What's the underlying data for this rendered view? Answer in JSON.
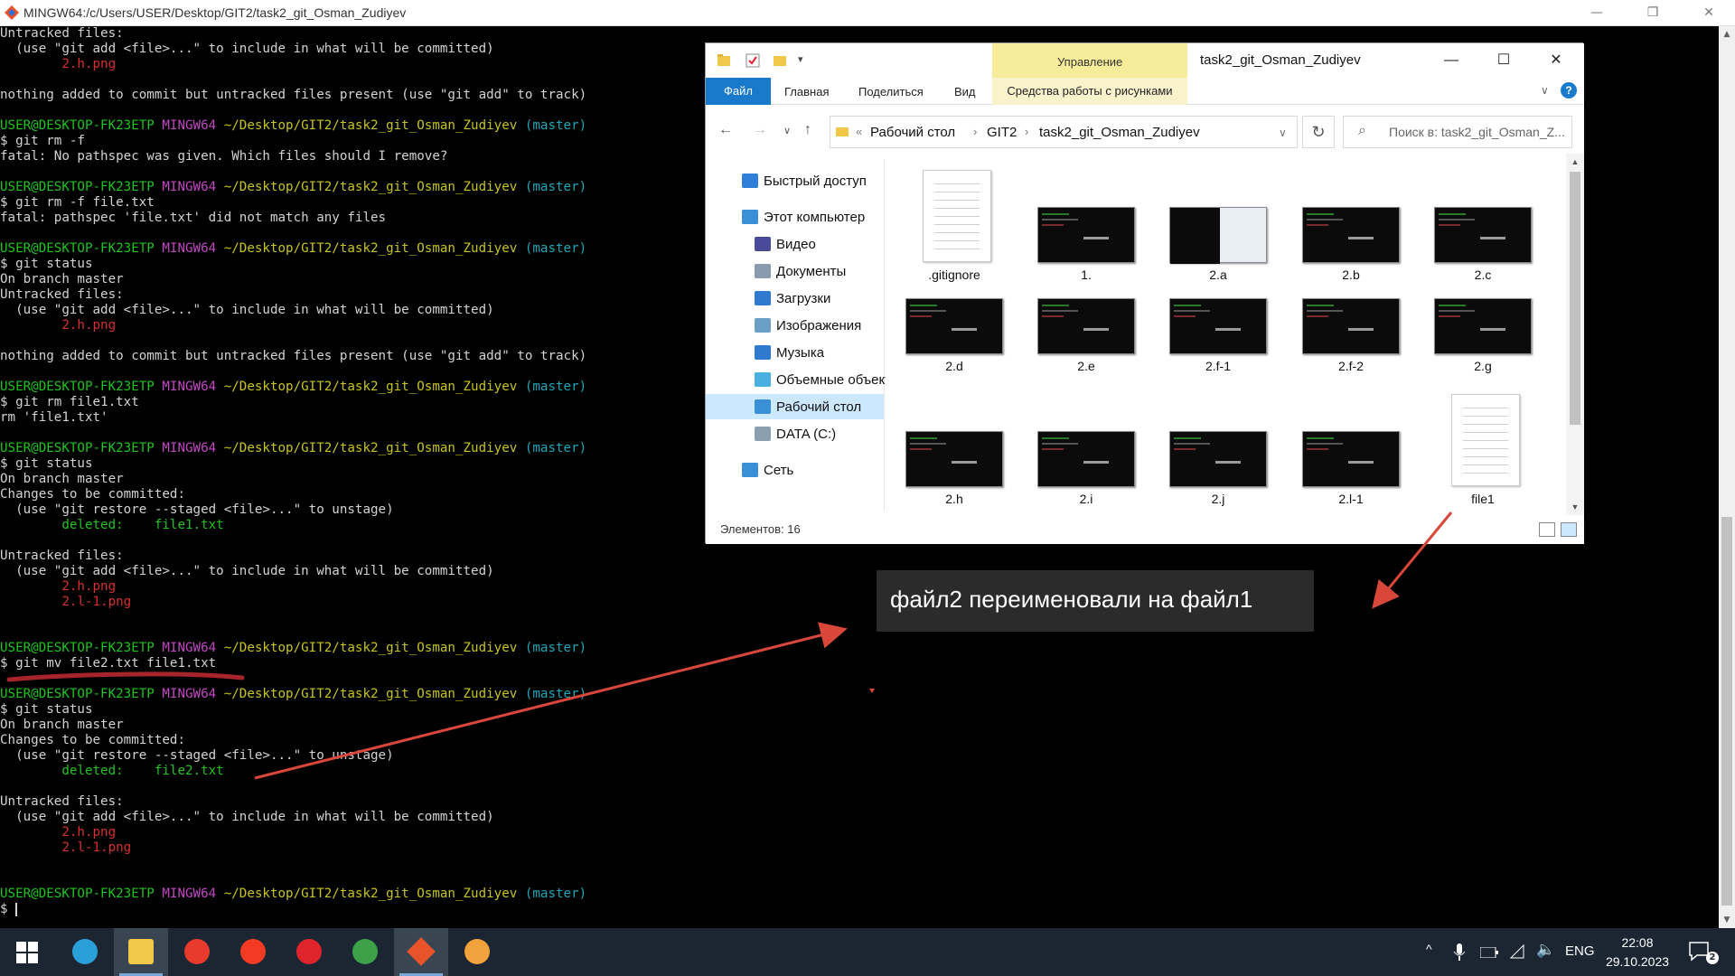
{
  "window": {
    "title": "MINGW64:/c/Users/USER/Desktop/GIT2/task2_git_Osman_Zudiyev",
    "minimize": "—",
    "maximize": "❐",
    "close": "✕"
  },
  "terminal": {
    "lines": [
      [
        [
          "w",
          "Untracked files:"
        ]
      ],
      [
        [
          "w",
          "  (use \"git add <file>...\" to include in what will be committed)"
        ]
      ],
      [
        [
          "r",
          "        2.h.png"
        ]
      ],
      [
        [
          "w",
          ""
        ]
      ],
      [
        [
          "w",
          "nothing added to commit but untracked files present (use \"git add\" to track)"
        ]
      ],
      [
        [
          "w",
          ""
        ]
      ],
      [
        [
          "g",
          "USER@DESKTOP-FK23ETP "
        ],
        [
          "m",
          "MINGW64 "
        ],
        [
          "y",
          "~/Desktop/GIT2/task2_git_Osman_Zudiyev "
        ],
        [
          "c",
          "(master)"
        ]
      ],
      [
        [
          "w",
          "$ git rm -f"
        ]
      ],
      [
        [
          "w",
          "fatal: No pathspec was given. Which files should I remove?"
        ]
      ],
      [
        [
          "w",
          ""
        ]
      ],
      [
        [
          "g",
          "USER@DESKTOP-FK23ETP "
        ],
        [
          "m",
          "MINGW64 "
        ],
        [
          "y",
          "~/Desktop/GIT2/task2_git_Osman_Zudiyev "
        ],
        [
          "c",
          "(master)"
        ]
      ],
      [
        [
          "w",
          "$ git rm -f file.txt"
        ]
      ],
      [
        [
          "w",
          "fatal: pathspec 'file.txt' did not match any files"
        ]
      ],
      [
        [
          "w",
          ""
        ]
      ],
      [
        [
          "g",
          "USER@DESKTOP-FK23ETP "
        ],
        [
          "m",
          "MINGW64 "
        ],
        [
          "y",
          "~/Desktop/GIT2/task2_git_Osman_Zudiyev "
        ],
        [
          "c",
          "(master)"
        ]
      ],
      [
        [
          "w",
          "$ git status"
        ]
      ],
      [
        [
          "w",
          "On branch master"
        ]
      ],
      [
        [
          "w",
          "Untracked files:"
        ]
      ],
      [
        [
          "w",
          "  (use \"git add <file>...\" to include in what will be committed)"
        ]
      ],
      [
        [
          "r",
          "        2.h.png"
        ]
      ],
      [
        [
          "w",
          ""
        ]
      ],
      [
        [
          "w",
          "nothing added to commit but untracked files present (use \"git add\" to track)"
        ]
      ],
      [
        [
          "w",
          ""
        ]
      ],
      [
        [
          "g",
          "USER@DESKTOP-FK23ETP "
        ],
        [
          "m",
          "MINGW64 "
        ],
        [
          "y",
          "~/Desktop/GIT2/task2_git_Osman_Zudiyev "
        ],
        [
          "c",
          "(master)"
        ]
      ],
      [
        [
          "w",
          "$ git rm file1.txt"
        ]
      ],
      [
        [
          "w",
          "rm 'file1.txt'"
        ]
      ],
      [
        [
          "w",
          ""
        ]
      ],
      [
        [
          "g",
          "USER@DESKTOP-FK23ETP "
        ],
        [
          "m",
          "MINGW64 "
        ],
        [
          "y",
          "~/Desktop/GIT2/task2_git_Osman_Zudiyev "
        ],
        [
          "c",
          "(master)"
        ]
      ],
      [
        [
          "w",
          "$ git status"
        ]
      ],
      [
        [
          "w",
          "On branch master"
        ]
      ],
      [
        [
          "w",
          "Changes to be committed:"
        ]
      ],
      [
        [
          "w",
          "  (use \"git restore --staged <file>...\" to unstage)"
        ]
      ],
      [
        [
          "g",
          "        deleted:    file1.txt"
        ]
      ],
      [
        [
          "w",
          ""
        ]
      ],
      [
        [
          "w",
          "Untracked files:"
        ]
      ],
      [
        [
          "w",
          "  (use \"git add <file>...\" to include in what will be committed)"
        ]
      ],
      [
        [
          "r",
          "        2.h.png"
        ]
      ],
      [
        [
          "r",
          "        2.l-1.png"
        ]
      ],
      [
        [
          "w",
          ""
        ]
      ],
      [
        [
          "w",
          ""
        ]
      ],
      [
        [
          "g",
          "USER@DESKTOP-FK23ETP "
        ],
        [
          "m",
          "MINGW64 "
        ],
        [
          "y",
          "~/Desktop/GIT2/task2_git_Osman_Zudiyev "
        ],
        [
          "c",
          "(master)"
        ]
      ],
      [
        [
          "w",
          "$ git mv file2.txt file1.txt"
        ]
      ],
      [
        [
          "w",
          ""
        ]
      ],
      [
        [
          "g",
          "USER@DESKTOP-FK23ETP "
        ],
        [
          "m",
          "MINGW64 "
        ],
        [
          "y",
          "~/Desktop/GIT2/task2_git_Osman_Zudiyev "
        ],
        [
          "c",
          "(master)"
        ]
      ],
      [
        [
          "w",
          "$ git status"
        ]
      ],
      [
        [
          "w",
          "On branch master"
        ]
      ],
      [
        [
          "w",
          "Changes to be committed:"
        ]
      ],
      [
        [
          "w",
          "  (use \"git restore --staged <file>...\" to unstage)"
        ]
      ],
      [
        [
          "g",
          "        deleted:    file2.txt"
        ]
      ],
      [
        [
          "w",
          ""
        ]
      ],
      [
        [
          "w",
          "Untracked files:"
        ]
      ],
      [
        [
          "w",
          "  (use \"git add <file>...\" to include in what will be committed)"
        ]
      ],
      [
        [
          "r",
          "        2.h.png"
        ]
      ],
      [
        [
          "r",
          "        2.l-1.png"
        ]
      ],
      [
        [
          "w",
          ""
        ]
      ],
      [
        [
          "w",
          ""
        ]
      ],
      [
        [
          "g",
          "USER@DESKTOP-FK23ETP "
        ],
        [
          "m",
          "MINGW64 "
        ],
        [
          "y",
          "~/Desktop/GIT2/task2_git_Osman_Zudiyev "
        ],
        [
          "c",
          "(master)"
        ]
      ],
      [
        [
          "w",
          "$ "
        ]
      ]
    ]
  },
  "annotation": {
    "text": "файл2 переименовали на файл1",
    "color": "#d9473a"
  },
  "explorer": {
    "title": "task2_git_Osman_Zudiyev",
    "context_tab": "Управление",
    "context_subtab": "Средства работы с рисунками",
    "ribbon_tabs": [
      "Файл",
      "Главная",
      "Поделиться",
      "Вид"
    ],
    "breadcrumb": [
      "Рабочий стол",
      "GIT2",
      "task2_git_Osman_Zudiyev"
    ],
    "breadcrumb_prefix": "«",
    "search_placeholder": "Поиск в: task2_git_Osman_Z...",
    "nav": [
      {
        "label": "Быстрый доступ",
        "icon": "star-icon",
        "color": "#2f7fd8"
      },
      {
        "label": "Этот компьютер",
        "icon": "computer-icon",
        "color": "#3a8fd9"
      },
      {
        "label": "Видео",
        "icon": "video-icon",
        "color": "#4a4a9a"
      },
      {
        "label": "Документы",
        "icon": "documents-icon",
        "color": "#8a9bb0"
      },
      {
        "label": "Загрузки",
        "icon": "downloads-icon",
        "color": "#2d7ad0"
      },
      {
        "label": "Изображения",
        "icon": "pictures-icon",
        "color": "#6aa0c8"
      },
      {
        "label": "Музыка",
        "icon": "music-icon",
        "color": "#2d7ad0"
      },
      {
        "label": "Объемные объекты",
        "icon": "3d-objects-icon",
        "color": "#4ab0e0"
      },
      {
        "label": "Рабочий стол",
        "icon": "desktop-icon",
        "color": "#3a8fd9",
        "selected": true
      },
      {
        "label": "DATA (C:)",
        "icon": "drive-icon",
        "color": "#8aa0b0"
      },
      {
        "label": "Сеть",
        "icon": "network-icon",
        "color": "#3a8fd9"
      }
    ],
    "files": [
      {
        "name": ".gitignore",
        "kind": "doc"
      },
      {
        "name": "1.",
        "kind": "img"
      },
      {
        "name": "2.a",
        "kind": "img-light"
      },
      {
        "name": "2.b",
        "kind": "img"
      },
      {
        "name": "2.c",
        "kind": "img"
      },
      {
        "name": "2.d",
        "kind": "img"
      },
      {
        "name": "2.e",
        "kind": "img"
      },
      {
        "name": "2.f-1",
        "kind": "img"
      },
      {
        "name": "2.f-2",
        "kind": "img"
      },
      {
        "name": "2.g",
        "kind": "img"
      },
      {
        "name": "2.h",
        "kind": "img"
      },
      {
        "name": "2.i",
        "kind": "img"
      },
      {
        "name": "2.j",
        "kind": "img"
      },
      {
        "name": "2.l-1",
        "kind": "img"
      },
      {
        "name": "file1",
        "kind": "doc"
      }
    ],
    "status": "Элементов: 16"
  },
  "taskbar": {
    "apps": [
      {
        "name": "start-icon"
      },
      {
        "name": "edge-icon",
        "color": "#2aa0d8"
      },
      {
        "name": "file-explorer-icon",
        "color": "#f2c84b",
        "active": true
      },
      {
        "name": "yandex-browser-icon",
        "color": "#e93b2d"
      },
      {
        "name": "yandex-icon",
        "color": "#f33a22"
      },
      {
        "name": "opera-icon",
        "color": "#e0242c"
      },
      {
        "name": "chrome-icon",
        "color": "#3da14a"
      },
      {
        "name": "git-bash-icon",
        "color": "#e8532a",
        "active": true
      },
      {
        "name": "paint-icon",
        "color": "#f0a23c"
      }
    ],
    "tray": {
      "chevron": "^",
      "lang": "ENG",
      "time": "22:08",
      "date": "29.10.2023",
      "notifications": "2"
    }
  }
}
